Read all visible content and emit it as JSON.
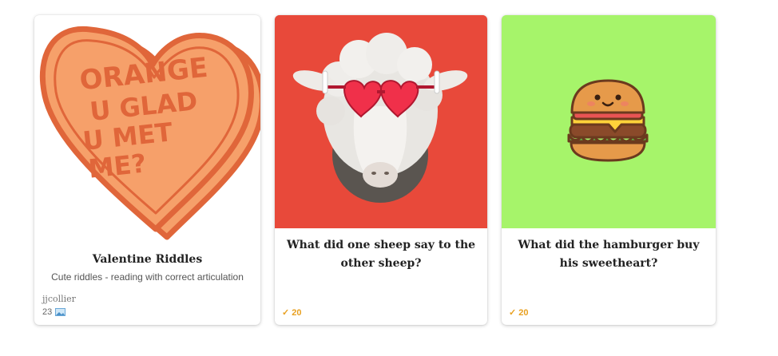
{
  "cards": [
    {
      "image_text_lines": [
        "ORANGE",
        "U GLAD",
        "U MET",
        "ME?"
      ],
      "title": "Valentine Riddles",
      "description": "Cute riddles - reading with correct articulation",
      "author": "jjcollier",
      "count": "23",
      "count_icon": "image-icon"
    },
    {
      "title": "What did one sheep say to the other sheep?",
      "score": "20",
      "score_icon": "check-icon",
      "background": "#e8493a"
    },
    {
      "title": "What did the hamburger buy his sweetheart?",
      "score": "20",
      "score_icon": "check-icon",
      "background": "#a6f46a"
    }
  ],
  "colors": {
    "heart_fill": "#f6a06a",
    "heart_stroke": "#e0663a",
    "check_accent": "#e8a020"
  }
}
